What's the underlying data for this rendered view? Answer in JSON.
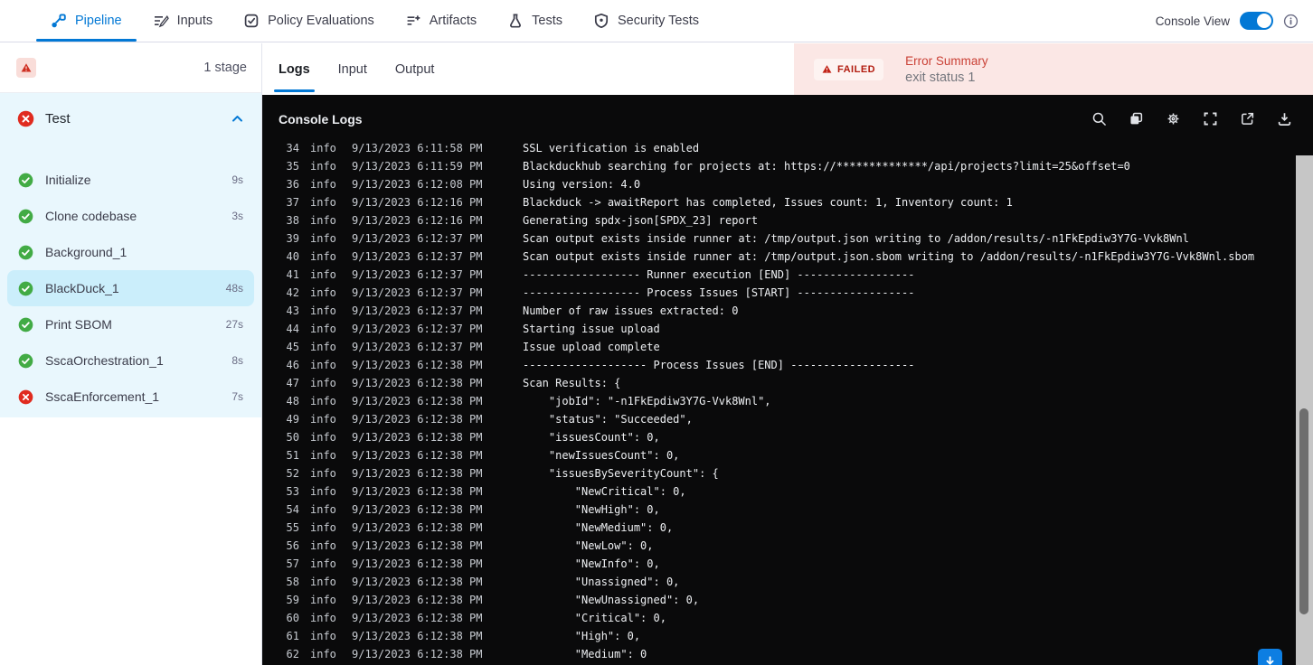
{
  "nav": {
    "tabs": [
      {
        "id": "pipeline",
        "label": "Pipeline",
        "icon": "pipeline",
        "active": true
      },
      {
        "id": "inputs",
        "label": "Inputs",
        "icon": "inputs",
        "active": false
      },
      {
        "id": "policy-evaluations",
        "label": "Policy Evaluations",
        "icon": "policy",
        "active": false
      },
      {
        "id": "artifacts",
        "label": "Artifacts",
        "icon": "artifacts",
        "active": false
      },
      {
        "id": "tests",
        "label": "Tests",
        "icon": "tests",
        "active": false
      },
      {
        "id": "security-tests",
        "label": "Security Tests",
        "icon": "security",
        "active": false
      }
    ],
    "console_view_label": "Console View",
    "console_view_toggle_on": true
  },
  "sidebar": {
    "stage_count_label": "1 stage",
    "stage": {
      "name": "Test",
      "status": "failed",
      "expanded": true,
      "steps": [
        {
          "label": "Initialize",
          "duration": "9s",
          "status": "success",
          "selected": false
        },
        {
          "label": "Clone codebase",
          "duration": "3s",
          "status": "success",
          "selected": false
        },
        {
          "label": "Background_1",
          "duration": "",
          "status": "success",
          "selected": false
        },
        {
          "label": "BlackDuck_1",
          "duration": "48s",
          "status": "success",
          "selected": true
        },
        {
          "label": "Print SBOM",
          "duration": "27s",
          "status": "success",
          "selected": false
        },
        {
          "label": "SscaOrchestration_1",
          "duration": "8s",
          "status": "success",
          "selected": false
        },
        {
          "label": "SscaEnforcement_1",
          "duration": "7s",
          "status": "failed",
          "selected": false
        }
      ]
    }
  },
  "content": {
    "tabs": [
      {
        "label": "Logs",
        "active": true
      },
      {
        "label": "Input",
        "active": false
      },
      {
        "label": "Output",
        "active": false
      }
    ],
    "error_summary": {
      "badge": "FAILED",
      "title": "Error Summary",
      "message": "exit status 1"
    },
    "console": {
      "title": "Console Logs",
      "toolbar": [
        "search",
        "copy",
        "settings",
        "fullscreen",
        "open-in-new",
        "download"
      ],
      "logs": [
        {
          "n": 34,
          "level": "info",
          "ts": "9/13/2023 6:11:58 PM",
          "msg": "SSL verification is enabled"
        },
        {
          "n": 35,
          "level": "info",
          "ts": "9/13/2023 6:11:59 PM",
          "msg": "Blackduckhub searching for projects at: https://**************/api/projects?limit=25&offset=0"
        },
        {
          "n": 36,
          "level": "info",
          "ts": "9/13/2023 6:12:08 PM",
          "msg": "Using version: 4.0"
        },
        {
          "n": 37,
          "level": "info",
          "ts": "9/13/2023 6:12:16 PM",
          "msg": "Blackduck -> awaitReport has completed, Issues count: 1, Inventory count: 1"
        },
        {
          "n": 38,
          "level": "info",
          "ts": "9/13/2023 6:12:16 PM",
          "msg": "Generating spdx-json[SPDX_23] report"
        },
        {
          "n": 39,
          "level": "info",
          "ts": "9/13/2023 6:12:37 PM",
          "msg": "Scan output exists inside runner at: /tmp/output.json writing to /addon/results/-n1FkEpdiw3Y7G-Vvk8Wnl"
        },
        {
          "n": 40,
          "level": "info",
          "ts": "9/13/2023 6:12:37 PM",
          "msg": "Scan output exists inside runner at: /tmp/output.json.sbom writing to /addon/results/-n1FkEpdiw3Y7G-Vvk8Wnl.sbom"
        },
        {
          "n": 41,
          "level": "info",
          "ts": "9/13/2023 6:12:37 PM",
          "msg": "------------------ Runner execution [END] ------------------"
        },
        {
          "n": 42,
          "level": "info",
          "ts": "9/13/2023 6:12:37 PM",
          "msg": "------------------ Process Issues [START] ------------------"
        },
        {
          "n": 43,
          "level": "info",
          "ts": "9/13/2023 6:12:37 PM",
          "msg": "Number of raw issues extracted: 0"
        },
        {
          "n": 44,
          "level": "info",
          "ts": "9/13/2023 6:12:37 PM",
          "msg": "Starting issue upload"
        },
        {
          "n": 45,
          "level": "info",
          "ts": "9/13/2023 6:12:37 PM",
          "msg": "Issue upload complete"
        },
        {
          "n": 46,
          "level": "info",
          "ts": "9/13/2023 6:12:38 PM",
          "msg": "------------------- Process Issues [END] -------------------"
        },
        {
          "n": 47,
          "level": "info",
          "ts": "9/13/2023 6:12:38 PM",
          "msg": "Scan Results: {"
        },
        {
          "n": 48,
          "level": "info",
          "ts": "9/13/2023 6:12:38 PM",
          "msg": "    \"jobId\": \"-n1FkEpdiw3Y7G-Vvk8Wnl\","
        },
        {
          "n": 49,
          "level": "info",
          "ts": "9/13/2023 6:12:38 PM",
          "msg": "    \"status\": \"Succeeded\","
        },
        {
          "n": 50,
          "level": "info",
          "ts": "9/13/2023 6:12:38 PM",
          "msg": "    \"issuesCount\": 0,"
        },
        {
          "n": 51,
          "level": "info",
          "ts": "9/13/2023 6:12:38 PM",
          "msg": "    \"newIssuesCount\": 0,"
        },
        {
          "n": 52,
          "level": "info",
          "ts": "9/13/2023 6:12:38 PM",
          "msg": "    \"issuesBySeverityCount\": {"
        },
        {
          "n": 53,
          "level": "info",
          "ts": "9/13/2023 6:12:38 PM",
          "msg": "        \"NewCritical\": 0,"
        },
        {
          "n": 54,
          "level": "info",
          "ts": "9/13/2023 6:12:38 PM",
          "msg": "        \"NewHigh\": 0,"
        },
        {
          "n": 55,
          "level": "info",
          "ts": "9/13/2023 6:12:38 PM",
          "msg": "        \"NewMedium\": 0,"
        },
        {
          "n": 56,
          "level": "info",
          "ts": "9/13/2023 6:12:38 PM",
          "msg": "        \"NewLow\": 0,"
        },
        {
          "n": 57,
          "level": "info",
          "ts": "9/13/2023 6:12:38 PM",
          "msg": "        \"NewInfo\": 0,"
        },
        {
          "n": 58,
          "level": "info",
          "ts": "9/13/2023 6:12:38 PM",
          "msg": "        \"Unassigned\": 0,"
        },
        {
          "n": 59,
          "level": "info",
          "ts": "9/13/2023 6:12:38 PM",
          "msg": "        \"NewUnassigned\": 0,"
        },
        {
          "n": 60,
          "level": "info",
          "ts": "9/13/2023 6:12:38 PM",
          "msg": "        \"Critical\": 0,"
        },
        {
          "n": 61,
          "level": "info",
          "ts": "9/13/2023 6:12:38 PM",
          "msg": "        \"High\": 0,"
        },
        {
          "n": 62,
          "level": "info",
          "ts": "9/13/2023 6:12:38 PM",
          "msg": "        \"Medium\": 0"
        }
      ]
    }
  },
  "colors": {
    "accent_blue": "#0278d5",
    "stage_panel_bg": "#e9f7fd",
    "selected_step_bg": "#cbeefb",
    "success_green": "#42ab45",
    "fail_red": "#e02b1f",
    "error_bar_bg": "#fbe7e5",
    "failed_text": "#b21c0f",
    "console_bg": "#0a0a0b",
    "scroll_button_bg": "#0d7ee2"
  }
}
